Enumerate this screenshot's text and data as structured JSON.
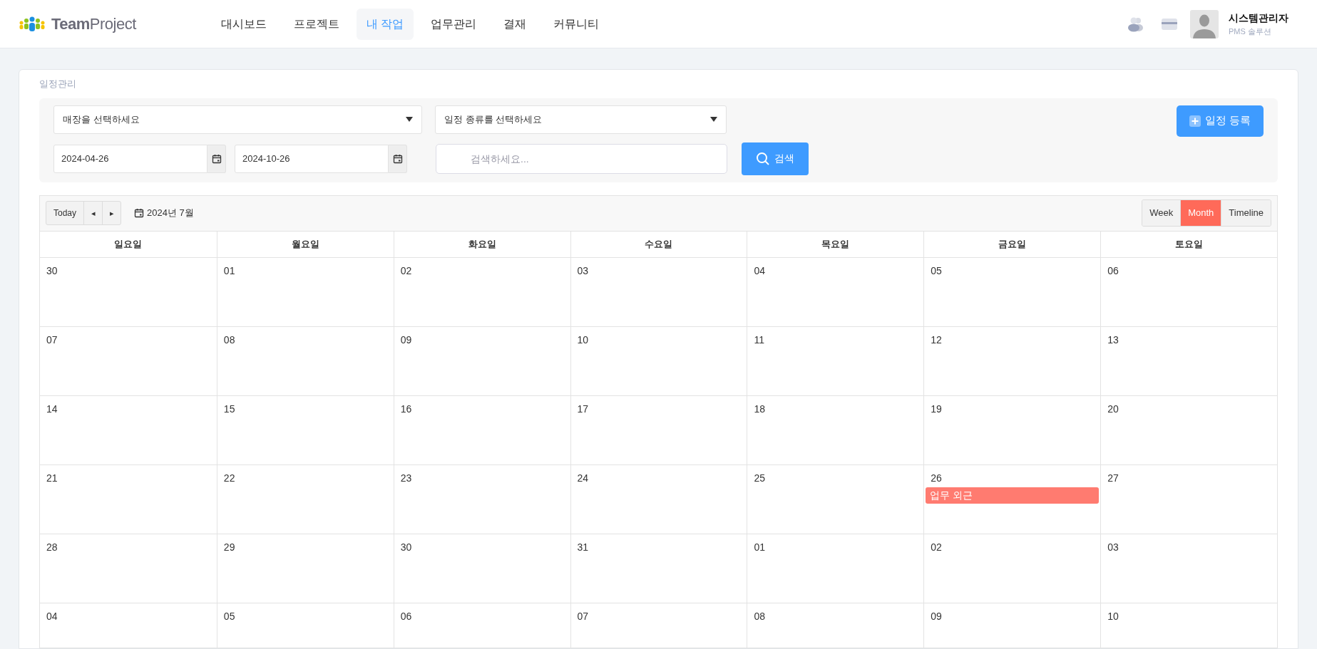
{
  "header": {
    "logo": {
      "bold": "Team",
      "light": "Project"
    },
    "nav": [
      {
        "label": "대시보드",
        "selected": false
      },
      {
        "label": "프로젝트",
        "selected": false
      },
      {
        "label": "내 작업",
        "selected": true
      },
      {
        "label": "업무관리",
        "selected": false
      },
      {
        "label": "결재",
        "selected": false
      },
      {
        "label": "커뮤니티",
        "selected": false
      }
    ],
    "user": {
      "name": "시스템관리자",
      "subtitle": "PMS 솔루션"
    }
  },
  "page_title": "일정관리",
  "filters": {
    "store_select": "매장을 선택하세요",
    "type_select": "일정 종류를 선택하세요",
    "date_from": "2024-04-26",
    "date_to": "2024-10-26",
    "search": {
      "placeholder": "검색하세요..."
    },
    "search_button": "검색",
    "add_button": "일정 등록"
  },
  "calendar": {
    "today_button": "Today",
    "prev_button": "◂",
    "next_button": "▸",
    "month_label": "2024년 7월",
    "views": [
      {
        "label": "Week",
        "selected": false
      },
      {
        "label": "Month",
        "selected": true
      },
      {
        "label": "Timeline",
        "selected": false
      }
    ],
    "weekdays": [
      "일요일",
      "월요일",
      "화요일",
      "수요일",
      "목요일",
      "금요일",
      "토요일"
    ],
    "weeks": [
      [
        {
          "date": "30"
        },
        {
          "date": "01"
        },
        {
          "date": "02"
        },
        {
          "date": "03"
        },
        {
          "date": "04"
        },
        {
          "date": "05"
        },
        {
          "date": "06"
        }
      ],
      [
        {
          "date": "07"
        },
        {
          "date": "08"
        },
        {
          "date": "09"
        },
        {
          "date": "10"
        },
        {
          "date": "11"
        },
        {
          "date": "12"
        },
        {
          "date": "13"
        }
      ],
      [
        {
          "date": "14"
        },
        {
          "date": "15"
        },
        {
          "date": "16"
        },
        {
          "date": "17"
        },
        {
          "date": "18"
        },
        {
          "date": "19"
        },
        {
          "date": "20"
        }
      ],
      [
        {
          "date": "21"
        },
        {
          "date": "22"
        },
        {
          "date": "23"
        },
        {
          "date": "24"
        },
        {
          "date": "25"
        },
        {
          "date": "26",
          "events": [
            {
              "title": "업무 외근",
              "color": "#ff7b70"
            }
          ]
        },
        {
          "date": "27"
        }
      ],
      [
        {
          "date": "28"
        },
        {
          "date": "29"
        },
        {
          "date": "30"
        },
        {
          "date": "31"
        },
        {
          "date": "01"
        },
        {
          "date": "02"
        },
        {
          "date": "03"
        }
      ],
      [
        {
          "date": "04"
        },
        {
          "date": "05"
        },
        {
          "date": "06"
        },
        {
          "date": "07"
        },
        {
          "date": "08"
        },
        {
          "date": "09"
        },
        {
          "date": "10"
        }
      ]
    ]
  }
}
